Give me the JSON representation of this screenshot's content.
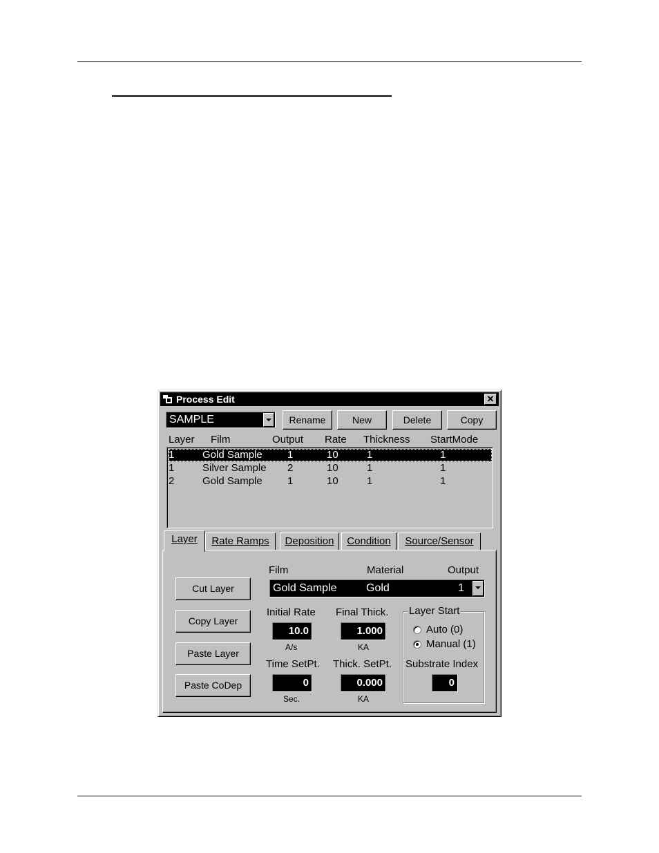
{
  "window": {
    "title": "Process Edit",
    "close_glyph": "✕"
  },
  "process_select": {
    "value": "SAMPLE"
  },
  "toolbar": {
    "rename": "Rename",
    "new": "New",
    "delete": "Delete",
    "copy": "Copy"
  },
  "layer_list": {
    "headers": [
      "Layer",
      "Film",
      "Output",
      "Rate",
      "Thickness",
      "StartMode"
    ],
    "rows": [
      {
        "layer": "1",
        "film": "Gold Sample",
        "output": "1",
        "rate": "10",
        "thickness": "1",
        "start_mode": "1",
        "selected": true
      },
      {
        "layer": "1",
        "film": "Silver Sample",
        "output": "2",
        "rate": "10",
        "thickness": "1",
        "start_mode": "1",
        "selected": false
      },
      {
        "layer": "2",
        "film": "Gold Sample",
        "output": "1",
        "rate": "10",
        "thickness": "1",
        "start_mode": "1",
        "selected": false
      }
    ]
  },
  "tabs": [
    "Layer",
    "Rate Ramps",
    "Deposition",
    "Condition",
    "Source/Sensor"
  ],
  "active_tab": "Layer",
  "layer_panel": {
    "buttons": {
      "cut": "Cut Layer",
      "copy": "Copy Layer",
      "paste": "Paste Layer",
      "paste_codep": "Paste CoDep"
    },
    "film_header": "Film",
    "material_header": "Material",
    "output_header": "Output",
    "film_value": "Gold Sample",
    "material_value": "Gold",
    "output_value": "1",
    "initial_rate_label": "Initial  Rate",
    "initial_rate_value": "10.0",
    "initial_rate_unit": "A/s",
    "final_thick_label": "Final Thick.",
    "final_thick_value": "1.000",
    "final_thick_unit": "KA",
    "time_setpt_label": "Time SetPt.",
    "time_setpt_value": "0",
    "time_setpt_unit": "Sec.",
    "thick_setpt_label": "Thick. SetPt.",
    "thick_setpt_value": "0.000",
    "thick_setpt_unit": "KA",
    "layer_start_label": "Layer Start",
    "auto_label": "Auto (0)",
    "manual_label": "Manual (1)",
    "selected_start": "Manual (1)",
    "substrate_index_label": "Substrate Index",
    "substrate_index_value": "0"
  }
}
